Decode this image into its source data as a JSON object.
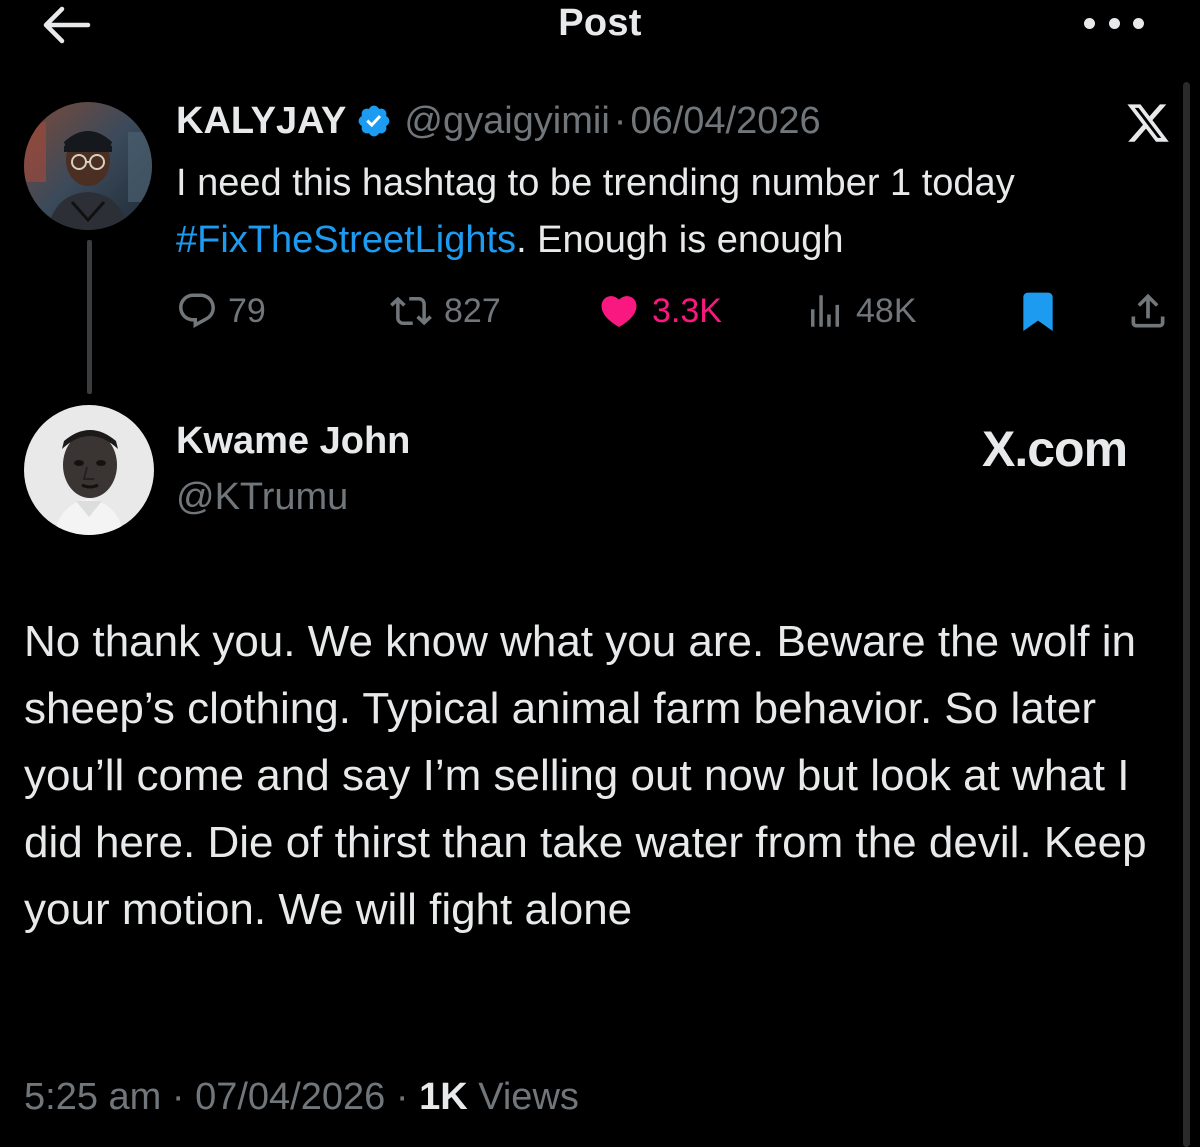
{
  "header": {
    "title": "Post",
    "back_icon": "arrow-left-icon",
    "more_icon": "more-horizontal-icon"
  },
  "quoted_post": {
    "display_name": "KALYJAY",
    "verified": true,
    "handle": "@gyaigyimii",
    "separator": "·",
    "date": "06/04/2026",
    "text_before": "I need this hashtag to be trending number 1 today",
    "hashtag": "#FixTheStreetLights",
    "text_after": ". Enough is enough",
    "stats": {
      "replies": "79",
      "reposts": "827",
      "likes": "3.3K",
      "views": "48K"
    },
    "liked": true,
    "bookmarked": true
  },
  "reply_post": {
    "display_name": "Kwame John",
    "handle": "@KTrumu",
    "site_label": "X.com",
    "text": "No thank you. We know what you are. Beware the wolf in sheep’s clothing. Typical animal farm behavior. So later you’ll come and say I’m selling out now but look at what I did here. Die of thirst than take water from the devil. Keep your motion. We will fight alone",
    "time": "5:25 am",
    "separator": "·",
    "date": "07/04/2026",
    "views_count": "1K",
    "views_label": "Views"
  },
  "colors": {
    "background": "#000000",
    "text": "#e7e9ea",
    "muted": "#71767b",
    "link": "#1d9bf0",
    "like": "#f91880",
    "verified": "#1d9bf0"
  }
}
